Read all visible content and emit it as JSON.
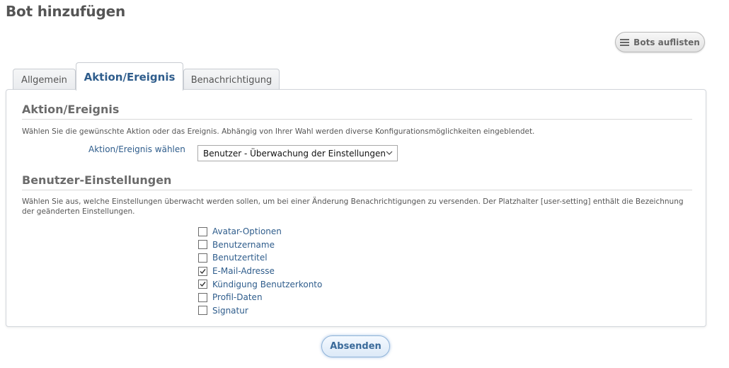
{
  "page": {
    "title": "Bot hinzufügen"
  },
  "header": {
    "list_bots_label": "Bots auflisten",
    "list_bots_icon": "list-icon"
  },
  "tabs": [
    {
      "label": "Allgemein",
      "active": false
    },
    {
      "label": "Aktion/Ereignis",
      "active": true
    },
    {
      "label": "Benachrichtigung",
      "active": false
    }
  ],
  "action_section": {
    "title": "Aktion/Ereignis",
    "description": "Wählen Sie die gewünschte Aktion oder das Ereignis. Abhängig von Ihrer Wahl werden diverse Konfigurationsmöglichkeiten eingeblendet.",
    "field_label": "Aktion/Ereignis wählen",
    "selected_value": "Benutzer - Überwachung der Einstellungen"
  },
  "settings_section": {
    "title": "Benutzer-Einstellungen",
    "description": "Wählen Sie aus, welche Einstellungen überwacht werden sollen, um bei einer Änderung Benachrichtigungen zu versenden. Der Platzhalter [user-setting] enthält die Bezeichnung der geänderten Einstellungen.",
    "options": [
      {
        "label": "Avatar-Optionen",
        "checked": false
      },
      {
        "label": "Benutzername",
        "checked": false
      },
      {
        "label": "Benutzertitel",
        "checked": false
      },
      {
        "label": "E-Mail-Adresse",
        "checked": true
      },
      {
        "label": "Kündigung Benutzerkonto",
        "checked": true
      },
      {
        "label": "Profil-Daten",
        "checked": false
      },
      {
        "label": "Signatur",
        "checked": false
      }
    ]
  },
  "footer": {
    "submit_label": "Absenden"
  },
  "colors": {
    "link_blue": "#2f5d8c",
    "heading_gray": "#6b6b6b"
  }
}
